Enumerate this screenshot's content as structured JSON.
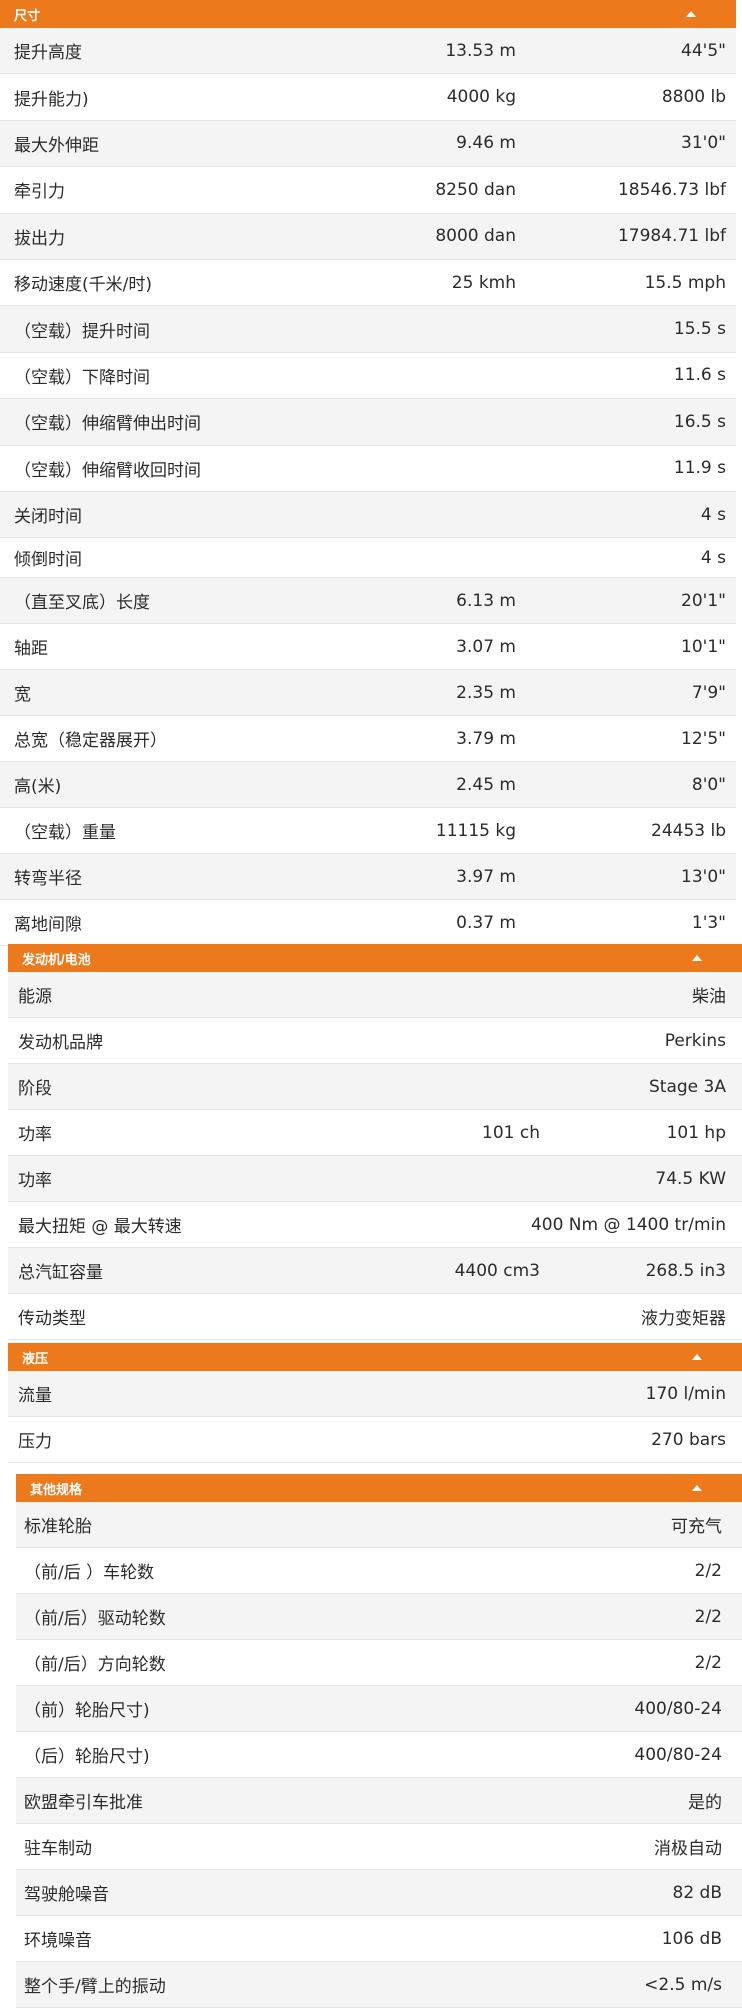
{
  "sections": [
    {
      "title": "尺寸",
      "rows": [
        {
          "label": "提升高度",
          "metric": "13.53 m",
          "imperial": "44'5\""
        },
        {
          "label": "提升能力)",
          "metric": "4000 kg",
          "imperial": "8800 lb"
        },
        {
          "label": "最大外伸距",
          "metric": "9.46 m",
          "imperial": "31'0\""
        },
        {
          "label": "牵引力",
          "metric": "8250 dan",
          "imperial": "18546.73 lbf"
        },
        {
          "label": "拔出力",
          "metric": "8000 dan",
          "imperial": "17984.71 lbf"
        },
        {
          "label": "移动速度(千米/时)",
          "metric": "25 kmh",
          "imperial": "15.5 mph"
        },
        {
          "label": "（空载）提升时间",
          "metric": "",
          "imperial": "15.5 s"
        },
        {
          "label": "（空载）下降时间",
          "metric": "",
          "imperial": "11.6 s"
        },
        {
          "label": "（空载）伸缩臂伸出时间",
          "metric": "",
          "imperial": "16.5 s"
        },
        {
          "label": "（空载）伸缩臂收回时间",
          "metric": "",
          "imperial": "11.9 s"
        },
        {
          "label": "关闭时间",
          "metric": "",
          "imperial": "4 s"
        },
        {
          "label": "倾倒时间",
          "metric": "",
          "imperial": "4 s"
        },
        {
          "label": "（直至叉底）长度",
          "metric": "6.13 m",
          "imperial": "20'1\""
        },
        {
          "label": "轴距",
          "metric": "3.07 m",
          "imperial": "10'1\""
        },
        {
          "label": "宽",
          "metric": "2.35 m",
          "imperial": "7'9\""
        },
        {
          "label": "总宽（稳定器展开）",
          "metric": "3.79 m",
          "imperial": "12'5\""
        },
        {
          "label": "高(米)",
          "metric": "2.45 m",
          "imperial": "8'0\""
        },
        {
          "label": "（空载）重量",
          "metric": "11115 kg",
          "imperial": "24453 lb"
        },
        {
          "label": "转弯半径",
          "metric": "3.97 m",
          "imperial": "13'0\""
        },
        {
          "label": "离地间隙",
          "metric": "0.37 m",
          "imperial": "1'3\""
        }
      ]
    },
    {
      "title": "发动机/电池",
      "rows": [
        {
          "label": "能源",
          "metric": "",
          "imperial": "柴油"
        },
        {
          "label": "发动机品牌",
          "metric": "",
          "imperial": "Perkins"
        },
        {
          "label": "阶段",
          "metric": "",
          "imperial": "Stage 3A"
        },
        {
          "label": "功率",
          "metric": "101 ch",
          "imperial": "101 hp"
        },
        {
          "label": "功率",
          "metric": "",
          "imperial": "74.5 KW"
        },
        {
          "label": "最大扭矩 @ 最大转速",
          "metric": "",
          "imperial": "400 Nm @ 1400 tr/min"
        },
        {
          "label": "总汽缸容量",
          "metric": "4400 cm3",
          "imperial": "268.5 in3"
        },
        {
          "label": "传动类型",
          "metric": "",
          "imperial": "液力变矩器"
        }
      ]
    },
    {
      "title": "液压",
      "rows": [
        {
          "label": "流量",
          "metric": "",
          "imperial": "170 l/min"
        },
        {
          "label": "压力",
          "metric": "",
          "imperial": "270 bars"
        }
      ]
    },
    {
      "title": "其他规格",
      "rows": [
        {
          "label": "标准轮胎",
          "metric": "",
          "imperial": "可充气"
        },
        {
          "label": "（前/后 ）车轮数",
          "metric": "",
          "imperial": "2/2"
        },
        {
          "label": "（前/后）驱动轮数",
          "metric": "",
          "imperial": "2/2"
        },
        {
          "label": "（前/后）方向轮数",
          "metric": "",
          "imperial": "2/2"
        },
        {
          "label": "（前）轮胎尺寸)",
          "metric": "",
          "imperial": "400/80-24"
        },
        {
          "label": "（后）轮胎尺寸)",
          "metric": "",
          "imperial": "400/80-24"
        },
        {
          "label": "欧盟牵引车批准",
          "metric": "",
          "imperial": "是的"
        },
        {
          "label": "驻车制动",
          "metric": "",
          "imperial": "消极自动"
        },
        {
          "label": "驾驶舱噪音",
          "metric": "",
          "imperial": "82 dB"
        },
        {
          "label": "环境噪音",
          "metric": "",
          "imperial": "106 dB"
        },
        {
          "label": "整个手/臂上的振动",
          "metric": "",
          "imperial": "<2.5 m/s"
        }
      ]
    }
  ]
}
